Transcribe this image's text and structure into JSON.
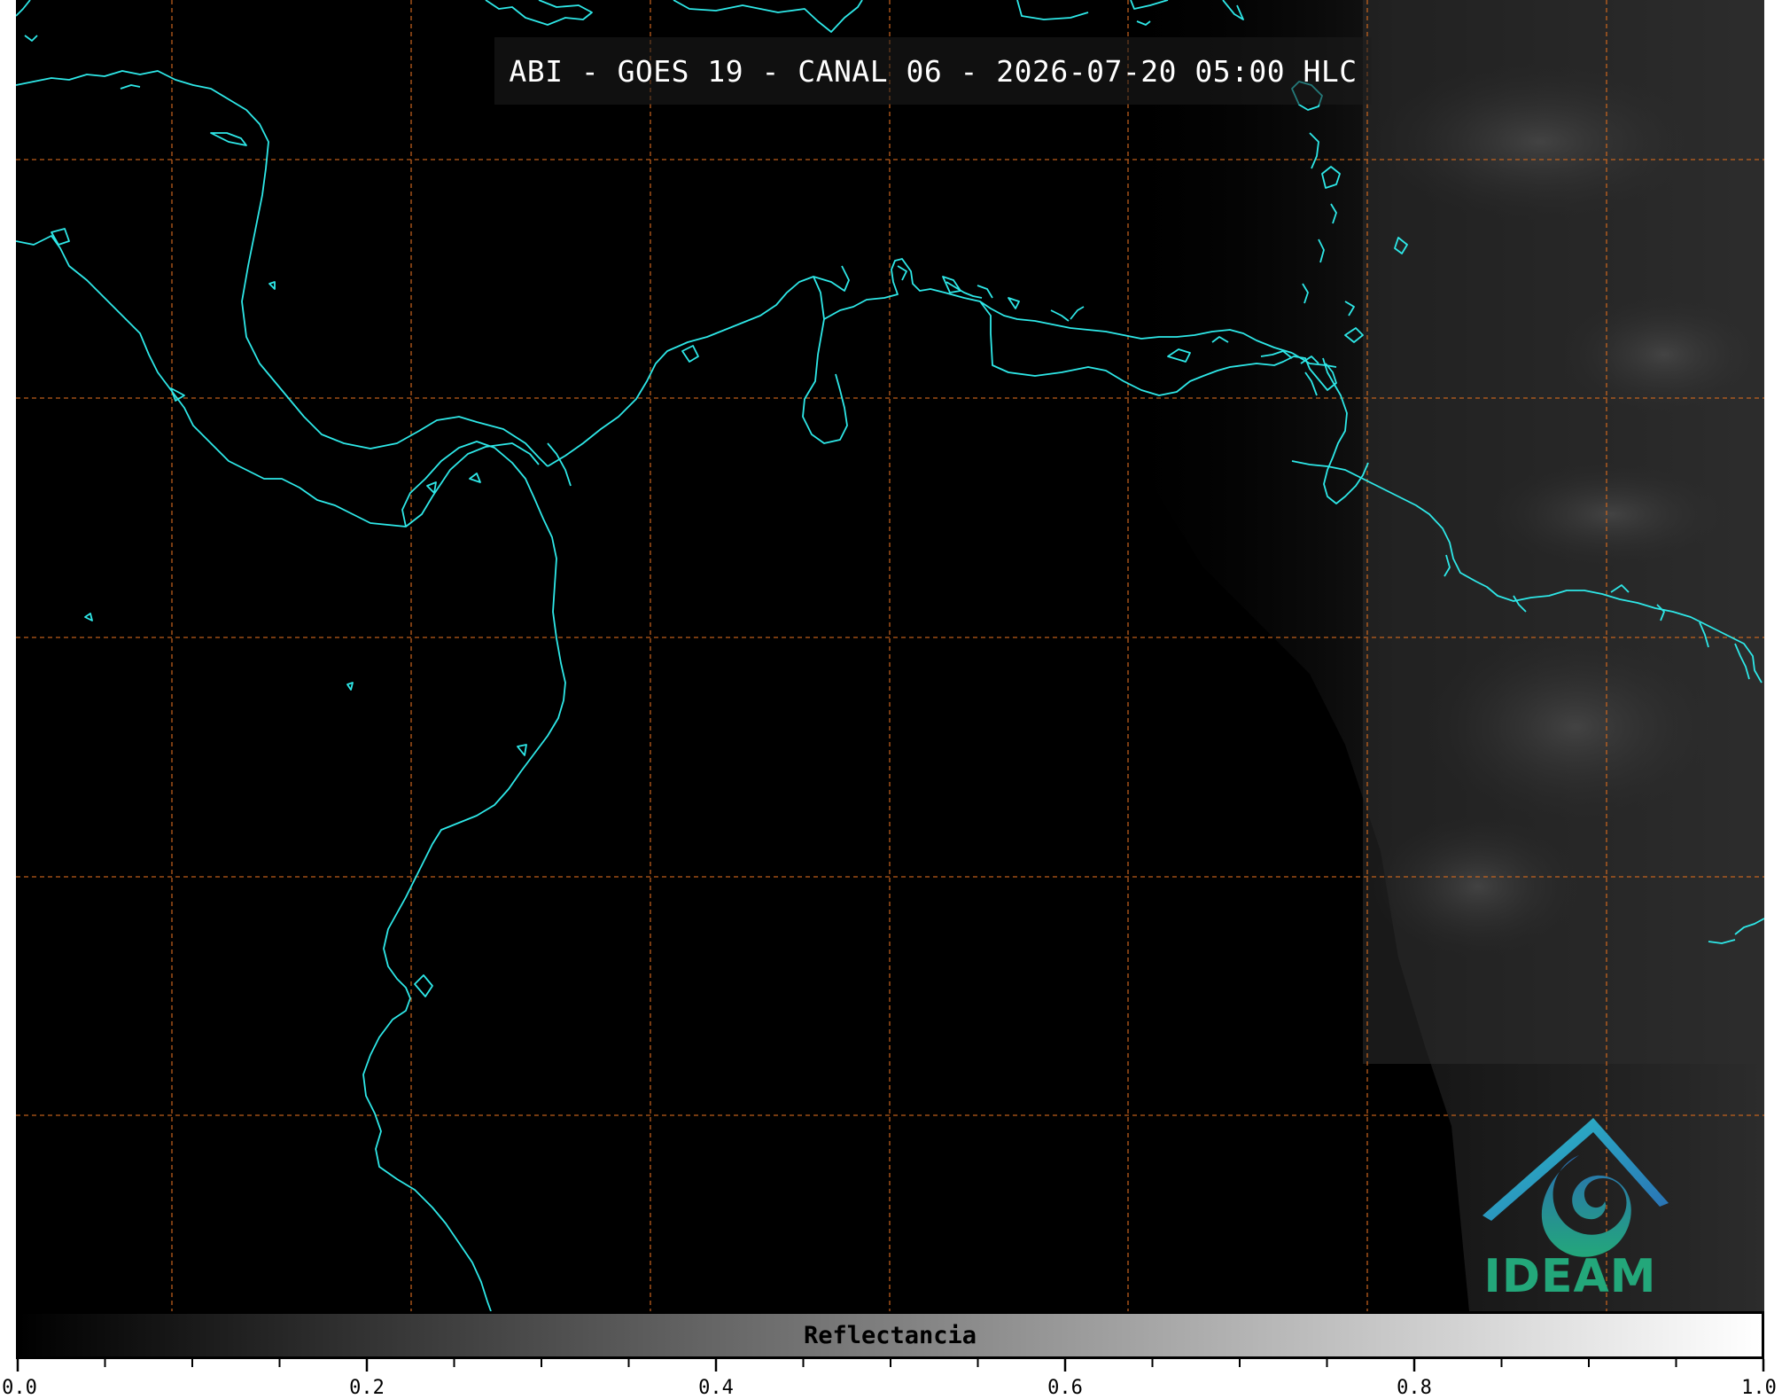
{
  "title": "ABI - GOES 19 - CANAL 06 - 2026-07-20 05:00 HLC",
  "logo": {
    "text": "IDEAM",
    "colors": [
      "#2a6fb4",
      "#23a77a",
      "#2bc0c9"
    ]
  },
  "colorbar": {
    "label": "Reflectancia",
    "min": 0.0,
    "max": 1.0,
    "colormap": [
      "#000000",
      "#ffffff"
    ],
    "major_ticks": [
      "0.0",
      "0.2",
      "0.4",
      "0.6",
      "0.8",
      "1.0"
    ],
    "minor_tick_step": 0.05
  },
  "map": {
    "background": "#000000",
    "coastline_color": "#2ee8e8",
    "gridline_color": "#d2691e",
    "gridline_style": "dashed",
    "cloud_region": "east (right third of image)"
  }
}
